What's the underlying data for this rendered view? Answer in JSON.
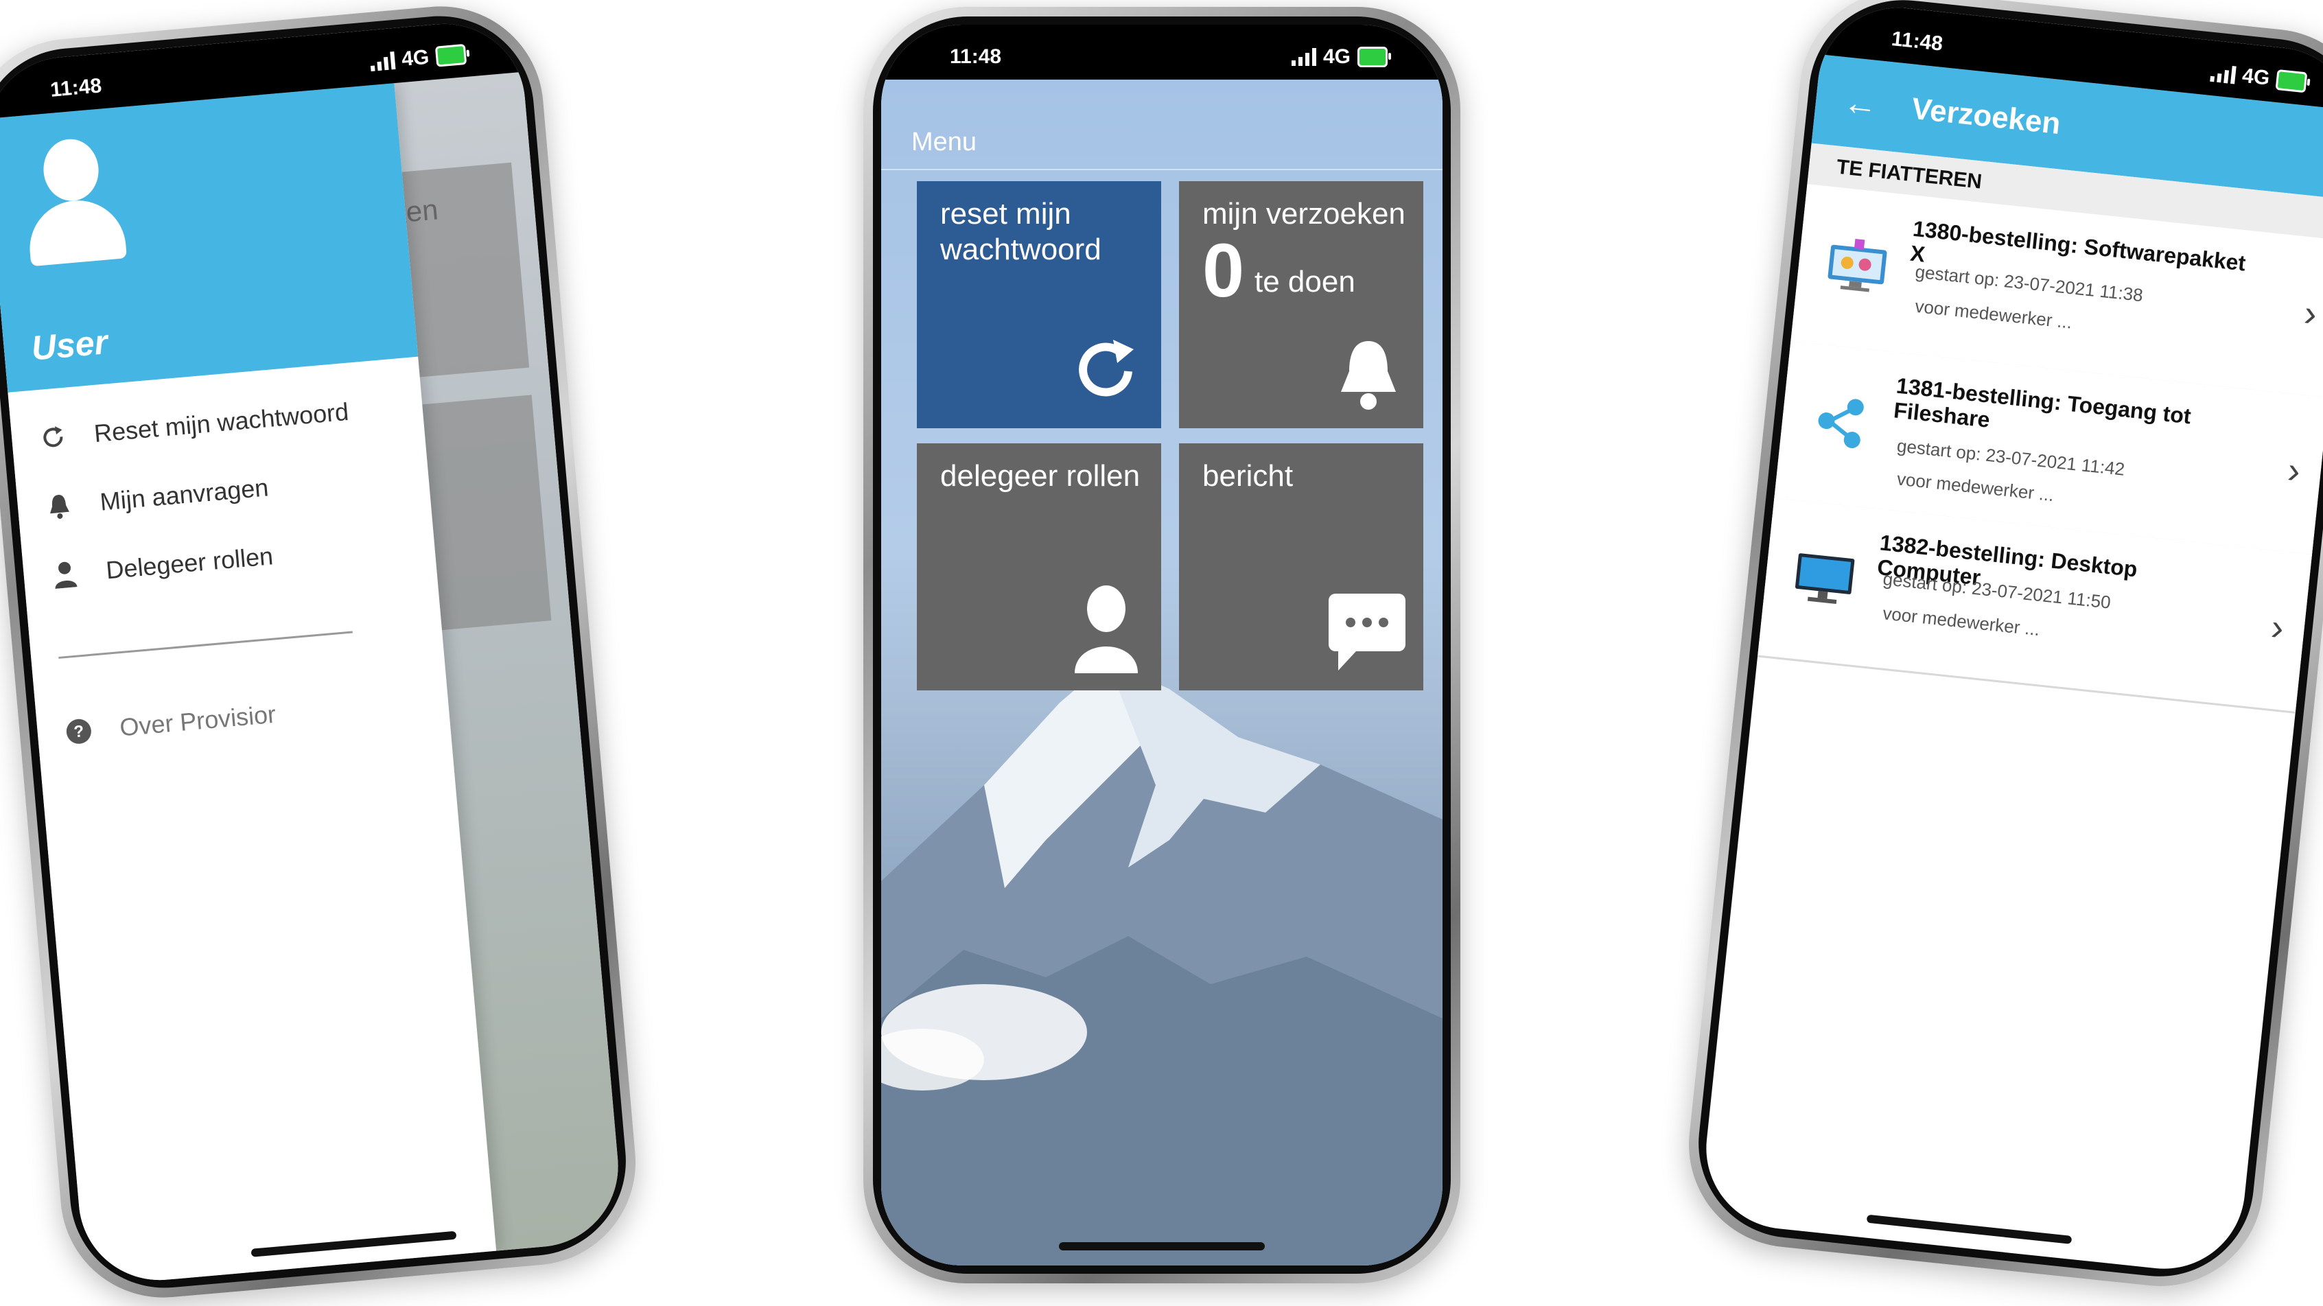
{
  "status": {
    "time": "11:48",
    "network": "4G"
  },
  "drawer": {
    "user_name": "User",
    "items": [
      {
        "label": "Reset mijn wachtwoord",
        "icon": "refresh-icon"
      },
      {
        "label": "Mijn aanvragen",
        "icon": "bell-icon"
      },
      {
        "label": "Delegeer rollen",
        "icon": "person-icon"
      }
    ],
    "about": {
      "label": "Over Provisior",
      "icon": "help-icon"
    },
    "background_peek_text": "ken"
  },
  "home": {
    "menu_label": "Menu",
    "tiles": [
      {
        "label": "reset mijn wachtwoord",
        "icon": "refresh-icon",
        "color": "#2d5b94"
      },
      {
        "label": "mijn verzoeken",
        "count": "0",
        "count_suffix": "te doen",
        "icon": "bell-icon",
        "color": "#656565"
      },
      {
        "label": "delegeer rollen",
        "icon": "person-icon",
        "color": "#656565"
      },
      {
        "label": "bericht",
        "icon": "chat-icon",
        "color": "#656565"
      }
    ]
  },
  "requests": {
    "title": "Verzoeken",
    "section": "TE FIATTEREN",
    "items": [
      {
        "title": "1380-bestelling: Softwarepakket X",
        "started": "gestart op: 23-07-2021 11:38",
        "for": "voor medewerker ...",
        "icon": "software-package-icon"
      },
      {
        "title": "1381-bestelling: Toegang tot Fileshare",
        "started": "gestart op: 23-07-2021 11:42",
        "for": "voor medewerker ...",
        "icon": "share-icon"
      },
      {
        "title": "1382-bestelling: Desktop Computer",
        "started": "gestart op: 23-07-2021 11:50",
        "for": "voor medewerker ...",
        "icon": "monitor-icon"
      }
    ]
  },
  "colors": {
    "accent": "#45b5e3",
    "tile_blue": "#2d5b94",
    "tile_grey": "#656565"
  }
}
